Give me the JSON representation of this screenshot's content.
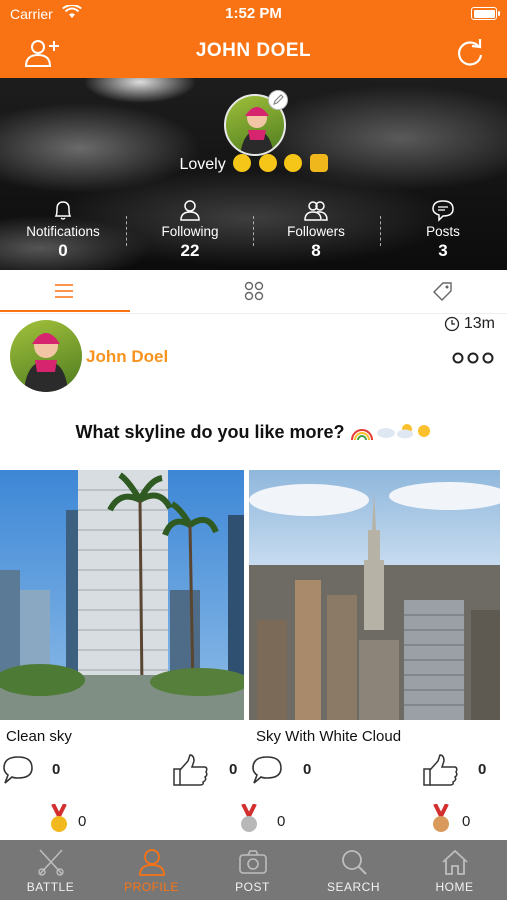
{
  "status_bar": {
    "carrier": "Carrier",
    "time": "1:52 PM"
  },
  "nav": {
    "title": "JOHN DOEL",
    "left_icon": "add-user-icon",
    "right_icon": "refresh-icon"
  },
  "profile": {
    "bio": "Lovely",
    "stats": [
      {
        "label": "Notifications",
        "value": "0",
        "icon": "bell-icon"
      },
      {
        "label": "Following",
        "value": "22",
        "icon": "person-icon"
      },
      {
        "label": "Followers",
        "value": "8",
        "icon": "people-icon"
      },
      {
        "label": "Posts",
        "value": "3",
        "icon": "chat-icon"
      }
    ]
  },
  "tabs": {
    "active": "list",
    "items": [
      "list-icon",
      "grid-icon",
      "tag-icon"
    ]
  },
  "post": {
    "author": "John Doel",
    "time_ago": "13m",
    "question": "What skyline do you like more?",
    "options": [
      {
        "caption": "Clean sky",
        "comments": "0",
        "likes": "0",
        "medals": "0"
      },
      {
        "caption": "Sky With White Cloud",
        "comments": "0",
        "likes": "0",
        "medals": "0"
      }
    ]
  },
  "tabbar": {
    "active": "PROFILE",
    "items": [
      {
        "label": "BATTLE",
        "icon": "battle-icon"
      },
      {
        "label": "PROFILE",
        "icon": "profile-icon"
      },
      {
        "label": "POST",
        "icon": "camera-icon"
      },
      {
        "label": "SEARCH",
        "icon": "search-icon"
      },
      {
        "label": "HOME",
        "icon": "home-icon"
      }
    ]
  },
  "colors": {
    "accent": "#f97314",
    "author": "#f7931e",
    "tabbar": "#777777"
  }
}
